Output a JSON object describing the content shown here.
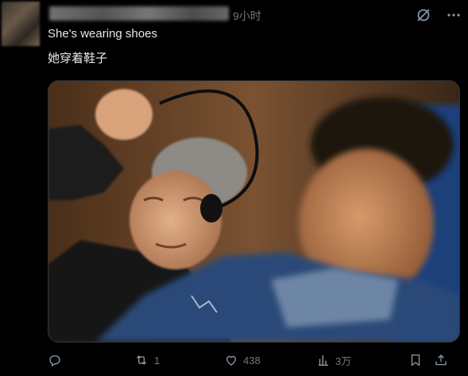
{
  "post": {
    "time": "9小时",
    "dot": "·",
    "text_line1": "She's wearing shoes",
    "text_line2": "她穿着鞋子"
  },
  "actions": {
    "reply_count": "",
    "retweet_count": "1",
    "like_count": "438",
    "views_count": "3万"
  },
  "icons": {
    "grok": "grok-icon",
    "more": "more-icon",
    "reply": "reply-icon",
    "retweet": "retweet-icon",
    "like": "heart-icon",
    "views": "views-icon",
    "bookmark": "bookmark-icon",
    "share": "share-icon"
  },
  "colors": {
    "background": "#000000",
    "text": "#e7e9ea",
    "muted": "#71767b"
  }
}
